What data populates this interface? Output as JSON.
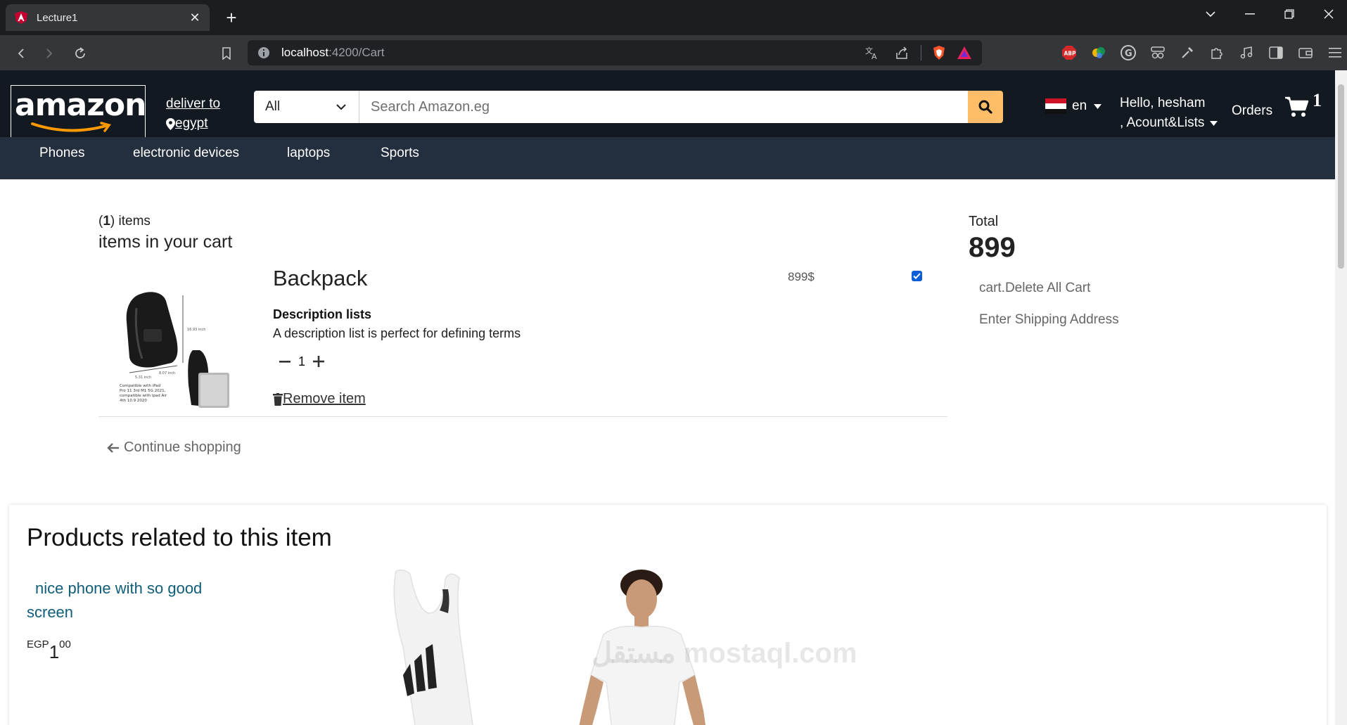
{
  "browser": {
    "tab_title": "Lecture1",
    "url_host": "localhost",
    "url_path": ":4200/Cart",
    "new_tab": "+",
    "close": "✕"
  },
  "header": {
    "logo": "amazon",
    "deliver_to": "deliver to",
    "deliver_location": "egypt",
    "search_category": "All",
    "search_placeholder": "Search Amazon.eg",
    "language": "en",
    "greeting": "Hello, hesham",
    "account_lists": ", Acount&Lists",
    "orders": "Orders",
    "cart_count": "1"
  },
  "subnav": {
    "items": [
      "Phones",
      "electronic devices",
      "laptops",
      "Sports"
    ]
  },
  "cart": {
    "count_prefix": "(",
    "count": "1",
    "count_suffix": ") items",
    "title": "items in your cart",
    "item": {
      "name": "Backpack",
      "desc_heading": "Description lists",
      "desc": "A description list is perfect for defining terms",
      "quantity": "1",
      "remove_label": "Remove item",
      "price": "899$"
    },
    "continue_label": "Continue shopping"
  },
  "summary": {
    "total_label": "Total",
    "total_value": "899",
    "delete_all": "cart.Delete All Cart",
    "shipping": "Enter Shipping Address"
  },
  "related": {
    "title": "Products related to this item",
    "product_name": "nice phone with so good screen",
    "currency": "EGP",
    "price_whole": "1",
    "price_fraction": "00",
    "watermark": "مستقل mostaql.com"
  },
  "colors": {
    "header_bg": "#131921",
    "subnav_bg": "#232f3e",
    "search_btn": "#febd69",
    "link": "#0f5d78",
    "checkbox": "#0b5ed7"
  }
}
